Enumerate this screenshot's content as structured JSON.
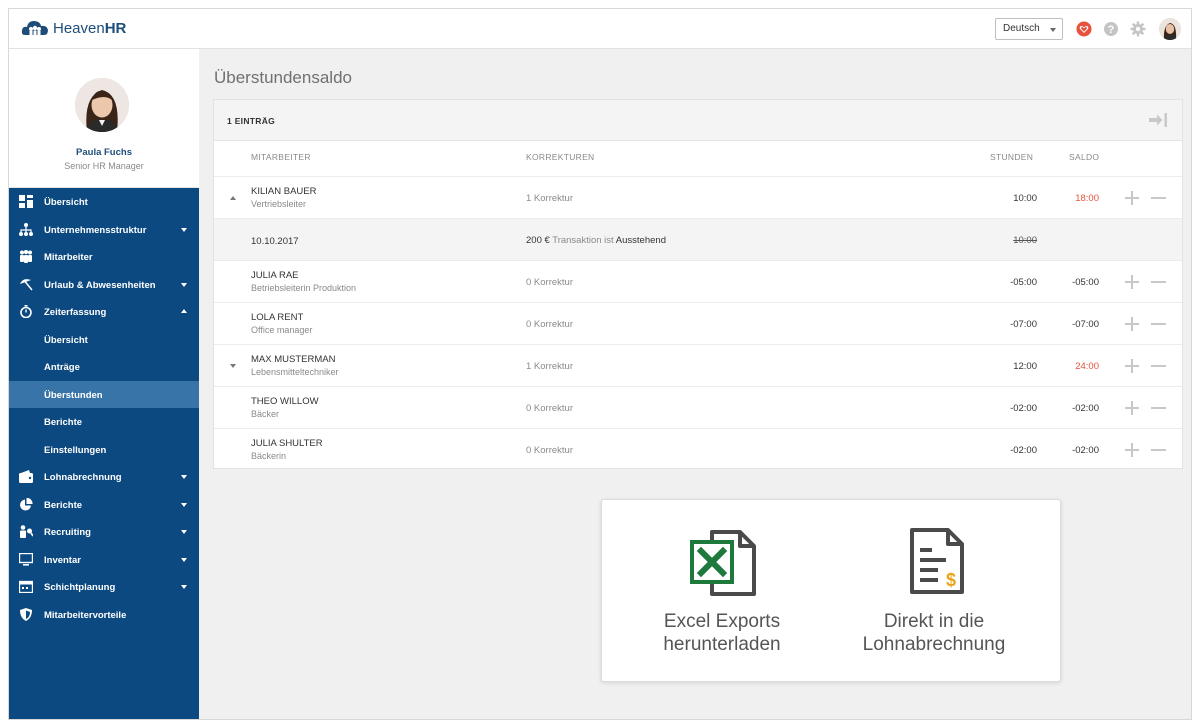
{
  "app": {
    "logo_plain": "Heaven",
    "logo_bold": "HR"
  },
  "topbar": {
    "language": "Deutsch"
  },
  "user": {
    "name": "Paula Fuchs",
    "role": "Senior HR Manager"
  },
  "nav": [
    {
      "label": "Übersicht",
      "icon": "dashboard-icon"
    },
    {
      "label": "Unternehmensstruktur",
      "icon": "org-chart-icon",
      "expandable": true
    },
    {
      "label": "Mitarbeiter",
      "icon": "people-icon"
    },
    {
      "label": "Urlaub & Abwesenheiten",
      "icon": "umbrella-icon",
      "expandable": true
    },
    {
      "label": "Zeiterfassung",
      "icon": "stopwatch-icon",
      "expanded": true
    },
    {
      "label": "Übersicht"
    },
    {
      "label": "Anträge"
    },
    {
      "label": "Überstunden",
      "active": true
    },
    {
      "label": "Berichte"
    },
    {
      "label": "Einstellungen"
    },
    {
      "label": "Lohnabrechnung",
      "icon": "wallet-icon",
      "expandable": true
    },
    {
      "label": "Berichte",
      "icon": "pie-chart-icon",
      "expandable": true
    },
    {
      "label": "Recruiting",
      "icon": "recruiting-icon",
      "expandable": true
    },
    {
      "label": "Inventar",
      "icon": "monitor-icon",
      "expandable": true
    },
    {
      "label": "Schichtplanung",
      "icon": "calendar-icon",
      "expandable": true
    },
    {
      "label": "Mitarbeitervorteile",
      "icon": "shield-icon"
    }
  ],
  "page": {
    "title": "Überstundensaldo",
    "count_label": "1 EINTRÄG"
  },
  "table": {
    "headers": {
      "employee": "MITARBEITER",
      "corrections": "KORREKTUREN",
      "hours": "STUNDEN",
      "balance": "SALDO"
    },
    "rows": [
      {
        "type": "employee",
        "toggle": "up",
        "name": "KILIAN BAUER",
        "role": "Vertriebsleiter",
        "corrections": "1 Korrektur",
        "hours": "10:00",
        "balance": "18:00",
        "balance_highlight": true
      },
      {
        "type": "detail",
        "date": "10.10.2017",
        "amount": "200 €",
        "mid": "Transaktion ist",
        "status": "Ausstehend",
        "hours": "10:00"
      },
      {
        "type": "employee",
        "name": "JULIA RAE",
        "role": "Betriebsleiterin Produktion",
        "corrections": "0 Korrektur",
        "hours": "-05:00",
        "balance": "-05:00"
      },
      {
        "type": "employee",
        "name": "LOLA RENT",
        "role": "Office manager",
        "corrections": "0 Korrektur",
        "hours": "-07:00",
        "balance": "-07:00"
      },
      {
        "type": "employee",
        "toggle": "down",
        "name": "MAX MUSTERMAN",
        "role": "Lebensmitteltechniker",
        "corrections": "1 Korrektur",
        "hours": "12:00",
        "balance": "24:00",
        "balance_highlight": true
      },
      {
        "type": "employee",
        "name": "THEO WILLOW",
        "role": "Bäcker",
        "corrections": "0 Korrektur",
        "hours": "-02:00",
        "balance": "-02:00"
      },
      {
        "type": "employee",
        "name": "JULIA SHULTER",
        "role": "Bäckerin",
        "corrections": "0 Korrektur",
        "hours": "-02:00",
        "balance": "-02:00"
      }
    ]
  },
  "promo": {
    "excel_line1": "Excel Exports",
    "excel_line2": "herunterladen",
    "payroll_line1": "Direkt in die",
    "payroll_line2": "Lohnabrechnung"
  },
  "colors": {
    "nav_bg": "#0b4980",
    "nav_active": "#3974a8",
    "accent_red": "#e8513c",
    "excel_green": "#1e7a3c",
    "brand_blue": "#1f4d7a"
  }
}
